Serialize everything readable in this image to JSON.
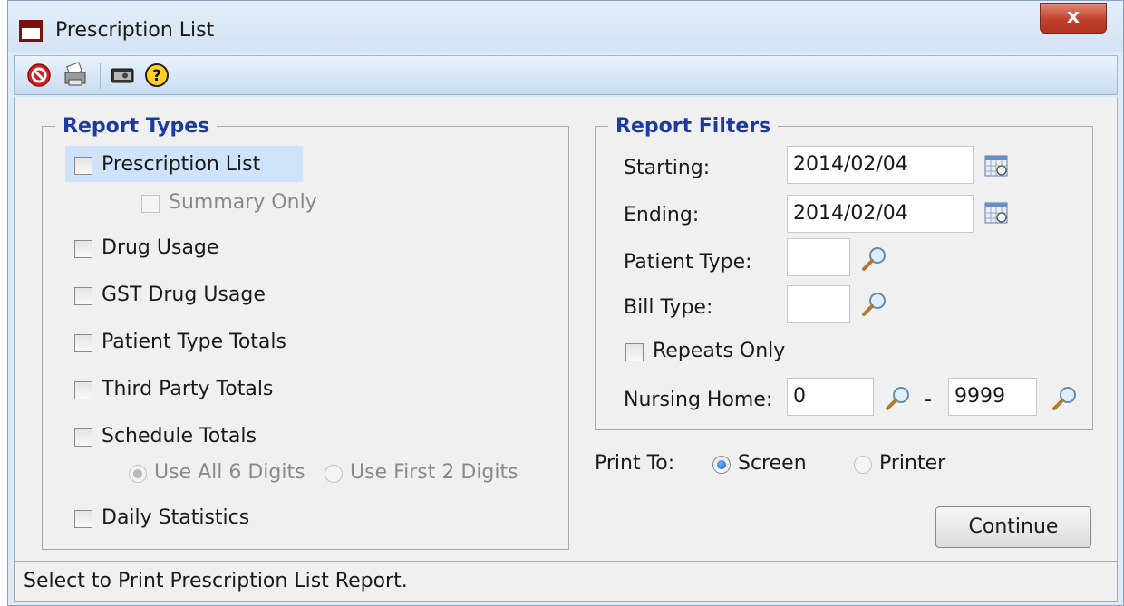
{
  "window": {
    "title": "Prescription List",
    "close_label": "x"
  },
  "toolbar": {
    "icons": [
      "cancel-icon",
      "print-icon",
      "preview-icon",
      "help-icon"
    ]
  },
  "report_types": {
    "legend": "Report Types",
    "prescription_list": "Prescription List",
    "summary_only": "Summary Only",
    "drug_usage": "Drug Usage",
    "gst_drug_usage": "GST Drug Usage",
    "patient_type_totals": "Patient Type Totals",
    "third_party_totals": "Third Party Totals",
    "schedule_totals": "Schedule Totals",
    "use_all_6_digits": "Use All 6 Digits",
    "use_first_2_digits": "Use First 2 Digits",
    "daily_statistics": "Daily Statistics"
  },
  "report_filters": {
    "legend": "Report Filters",
    "starting_label": "Starting:",
    "starting_value": "2014/02/04",
    "ending_label": "Ending:",
    "ending_value": "2014/02/04",
    "patient_type_label": "Patient Type:",
    "patient_type_value": "",
    "bill_type_label": "Bill Type:",
    "bill_type_value": "",
    "repeats_only": "Repeats Only",
    "nursing_home_label": "Nursing Home:",
    "nursing_home_from": "0",
    "range_separator": "-",
    "nursing_home_to": "9999"
  },
  "print_to": {
    "label": "Print To:",
    "screen": "Screen",
    "printer": "Printer",
    "selected": "Screen"
  },
  "continue_label": "Continue",
  "status_text": "Select to Print Prescription List Report.",
  "colors": {
    "legend": "#1b3aa3",
    "highlight": "#cfe3fb",
    "close": "#c0402a"
  }
}
